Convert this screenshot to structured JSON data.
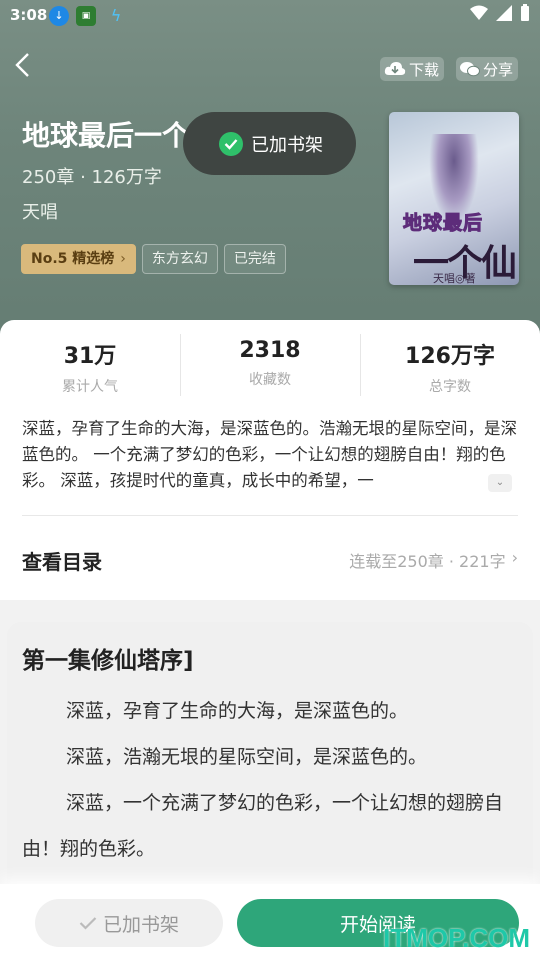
{
  "status_bar": {
    "time": "3:08"
  },
  "header": {
    "download_label": "下载",
    "share_label": "分享"
  },
  "book": {
    "title": "地球最后一个仙门",
    "meta": "250章 · 126万字",
    "author": "天唱",
    "tags": [
      "No.5 精选榜",
      "东方玄幻",
      "已完结"
    ],
    "cover": {
      "title_line1": "地球最后",
      "title_line2": "一个仙门",
      "author": "天唱◎著"
    }
  },
  "toast": {
    "text": "已加书架"
  },
  "stats": [
    {
      "value": "31万",
      "label": "累计人气"
    },
    {
      "value": "2318",
      "label": "收藏数"
    },
    {
      "value": "126万字",
      "label": "总字数"
    }
  ],
  "intro": "深蓝，孕育了生命的大海，是深蓝色的。浩瀚无垠的星际空间，是深蓝色的。 一个充满了梦幻的色彩，一个让幻想的翅膀自由！翔的色彩。 深蓝，孩提时代的童真，成长中的希望，一",
  "toc": {
    "title": "查看目录",
    "status": "连载至250章 · 221字"
  },
  "chapter": {
    "title": "第一集修仙塔序]",
    "paragraphs": [
      "深蓝，孕育了生命的大海，是深蓝色的。",
      "深蓝，浩瀚无垠的星际空间，是深蓝色的。",
      "深蓝，一个充满了梦幻的色彩，一个让幻想的翅膀自由！翔的色彩。"
    ]
  },
  "bottom_bar": {
    "shelf_label": "已加书架",
    "read_label": "开始阅读"
  },
  "watermark": "ITMOP.COM",
  "colors": {
    "accent": "#2ea67a",
    "hero_bg": "#6e857b",
    "rank_tag": "#d9b97c"
  }
}
